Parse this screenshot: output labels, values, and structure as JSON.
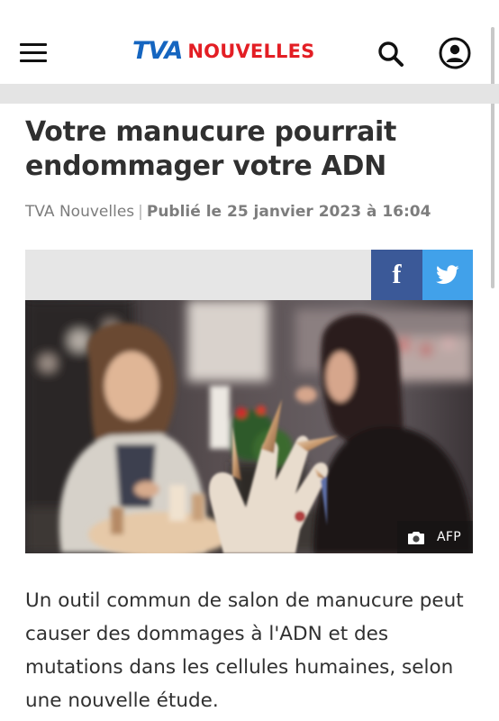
{
  "header": {
    "logo_tva": "TVA",
    "logo_nouvelles": "NOUVELLES",
    "menu_icon": "hamburger-menu-icon",
    "search_icon": "search-icon",
    "account_icon": "account-icon",
    "brand_blue": "#1565c0",
    "brand_red": "#e31e24"
  },
  "article": {
    "title": "Votre manucure pourrait endommager votre ADN",
    "source": "TVA Nouvelles",
    "separator": "|",
    "published": "Publié le 25 janvier 2023 à 16:04",
    "share": {
      "facebook_icon": "facebook-icon",
      "twitter_icon": "twitter-icon",
      "facebook_color": "#3b5998",
      "twitter_color": "#41a1ea"
    },
    "photo": {
      "credit_icon": "camera-icon",
      "credit": "AFP"
    },
    "lede": "Un outil commun de salon de manucure peut causer des dommages à l'ADN et des mutations dans les cellules humaines, selon une nouvelle étude."
  }
}
